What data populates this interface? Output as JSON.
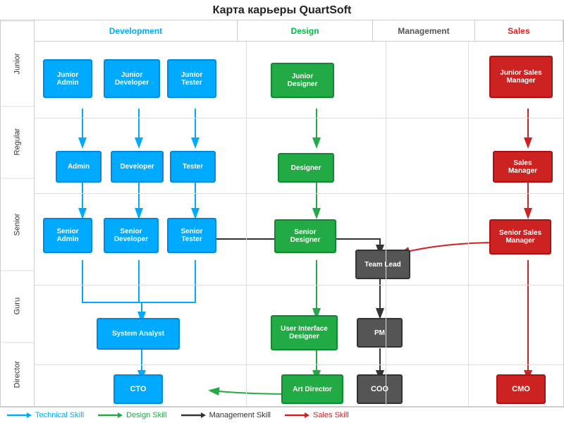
{
  "title": "Карта карьеры QuartSoft",
  "col_headers": {
    "dev": "Development",
    "design": "Design",
    "mgmt": "Management",
    "sales": "Sales"
  },
  "row_labels": [
    "Junior",
    "Regular",
    "Senior",
    "Guru",
    "Director"
  ],
  "boxes": {
    "junior_admin": "Junior\nAdmin",
    "junior_developer": "Junior\nDeveloper",
    "junior_tester": "Junior\nTester",
    "junior_designer": "Junior Designer",
    "junior_sales": "Junior Sales\nManager",
    "admin": "Admin",
    "developer": "Developer",
    "tester": "Tester",
    "designer": "Designer",
    "sales_manager": "Sales\nManager",
    "senior_admin": "Senior\nAdmin",
    "senior_developer": "Senior\nDeveloper",
    "senior_tester": "Senior\nTester",
    "senior_designer": "Senior\nDesigner",
    "team_lead": "Team Lead",
    "senior_sales": "Senior Sales\nManager",
    "system_analyst": "System Analyst",
    "ui_designer": "User Interface\nDesigner",
    "pm": "PM",
    "cto": "CTO",
    "art_director": "Art Director",
    "coo": "COO",
    "cmo": "CMO"
  },
  "legend": {
    "technical": "Technical Skill",
    "design": "Design Skill",
    "management": "Management Skill",
    "sales": "Sales Skill"
  }
}
